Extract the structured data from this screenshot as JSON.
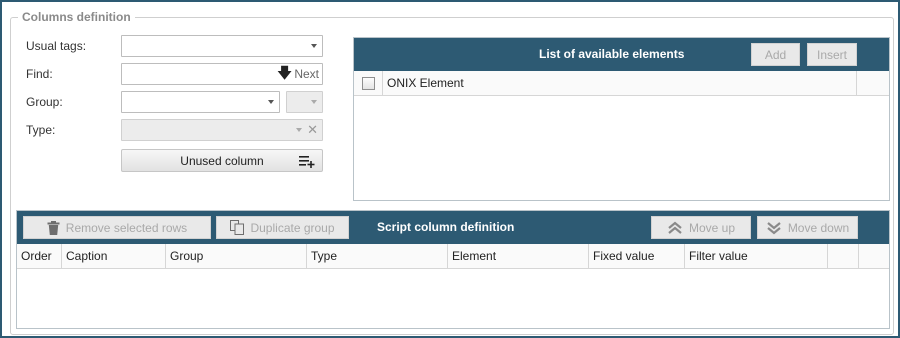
{
  "groupbox": {
    "title": "Columns definition"
  },
  "form": {
    "usual_tags": {
      "label": "Usual tags:",
      "value": ""
    },
    "find": {
      "label": "Find:",
      "value": "",
      "next_label": "Next"
    },
    "group": {
      "label": "Group:",
      "value": "",
      "secondary_value": ""
    },
    "type": {
      "label": "Type:",
      "value": ""
    },
    "unused_column_label": "Unused column"
  },
  "available": {
    "title": "List of available elements",
    "add_label": "Add",
    "insert_label": "Insert",
    "columns": [
      "ONIX Element"
    ],
    "rows": []
  },
  "script": {
    "title": "Script column definition",
    "remove_label": "Remove selected rows",
    "duplicate_label": "Duplicate group",
    "move_up_label": "Move up",
    "move_down_label": "Move down",
    "columns": [
      "Order",
      "Caption",
      "Group",
      "Type",
      "Element",
      "Fixed value",
      "Filter value"
    ],
    "rows": []
  },
  "colors": {
    "header": "#2d5a73",
    "disabled_text": "#a9a9a9"
  }
}
